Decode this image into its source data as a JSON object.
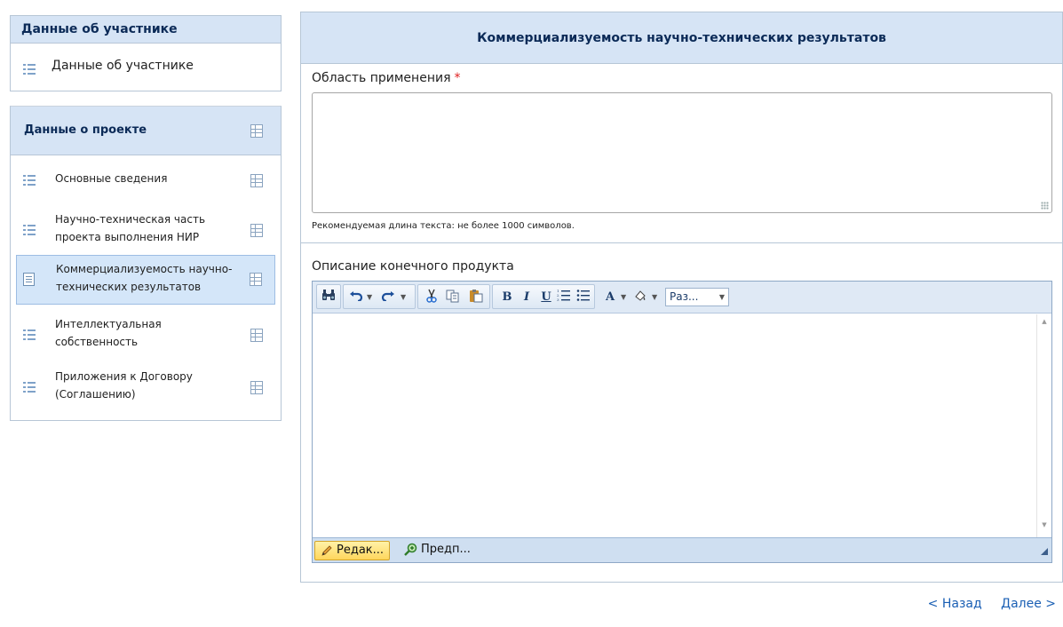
{
  "sidebar": {
    "participant": {
      "header": "Данные об участнике",
      "item": "Данные об участнике"
    },
    "project": {
      "header": "Данные о проекте",
      "items": [
        {
          "label": "Основные сведения"
        },
        {
          "label": "Научно-техническая часть проекта выполнения НИР"
        },
        {
          "label": "Коммерциализуемость научно-технических результатов",
          "active": true
        },
        {
          "label": "Интеллектуальная собственность"
        },
        {
          "label": "Приложения к Договору (Соглашению)"
        }
      ]
    }
  },
  "main": {
    "title": "Коммерциализуемость научно-технических результатов",
    "field1": {
      "label": "Область применения",
      "required_mark": "*",
      "value": "",
      "hint": "Рекомендуемая длина текста: не более 1000 символов."
    },
    "field2": {
      "label": "Описание конечного продукта",
      "font_size_select": "Раз...",
      "mode_edit": "Редак...",
      "mode_preview": "Предп..."
    }
  },
  "navigation": {
    "back": "< Назад",
    "next": "Далее >"
  },
  "colors": {
    "header_bg": "#d6e4f5",
    "header_text": "#0b2a57",
    "link": "#1a5fb4",
    "required": "#e02020",
    "active_mode": "#ffd65c"
  }
}
